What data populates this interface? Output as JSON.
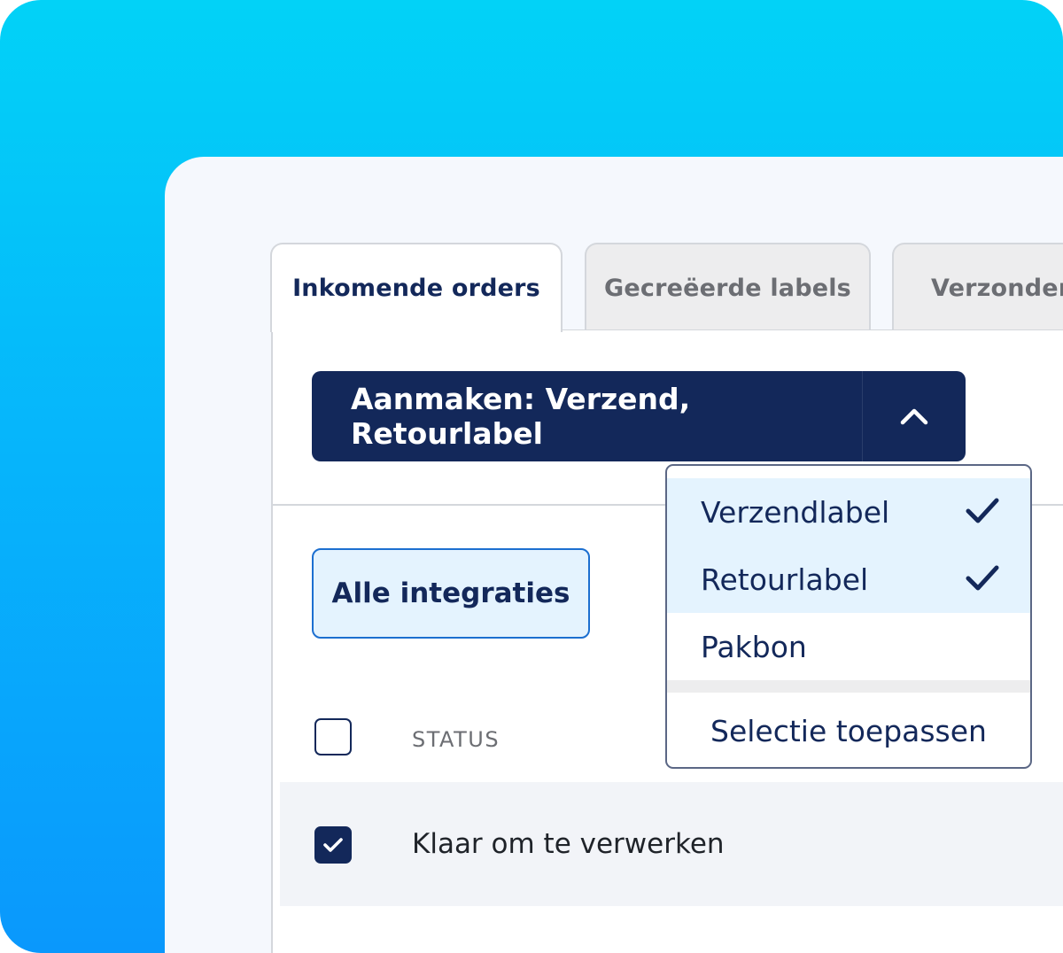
{
  "tabs": [
    {
      "label": "Inkomende orders",
      "active": true
    },
    {
      "label": "Gecreëerde labels",
      "active": false
    },
    {
      "label": "Verzonden",
      "active": false
    }
  ],
  "create_button": {
    "label": "Aanmaken: Verzend, Retourlabel",
    "icon": "chevron-up-icon"
  },
  "filter_button": {
    "label": "Alle integraties"
  },
  "dropdown": {
    "options": [
      {
        "label": "Verzendlabel",
        "checked": true
      },
      {
        "label": "Retourlabel",
        "checked": true
      },
      {
        "label": "Pakbon",
        "checked": false
      }
    ],
    "apply_label": "Selectie toepassen"
  },
  "table": {
    "header": {
      "status": "STATUS"
    },
    "rows": [
      {
        "status": "Klaar om te verwerken",
        "checked": true
      }
    ]
  },
  "colors": {
    "navy": "#13285a",
    "accent_blue": "#1c6fd0",
    "light_blue": "#e4f3fe",
    "background_gradient_top": "#02d2f7",
    "background_gradient_bottom": "#0a98fc"
  }
}
